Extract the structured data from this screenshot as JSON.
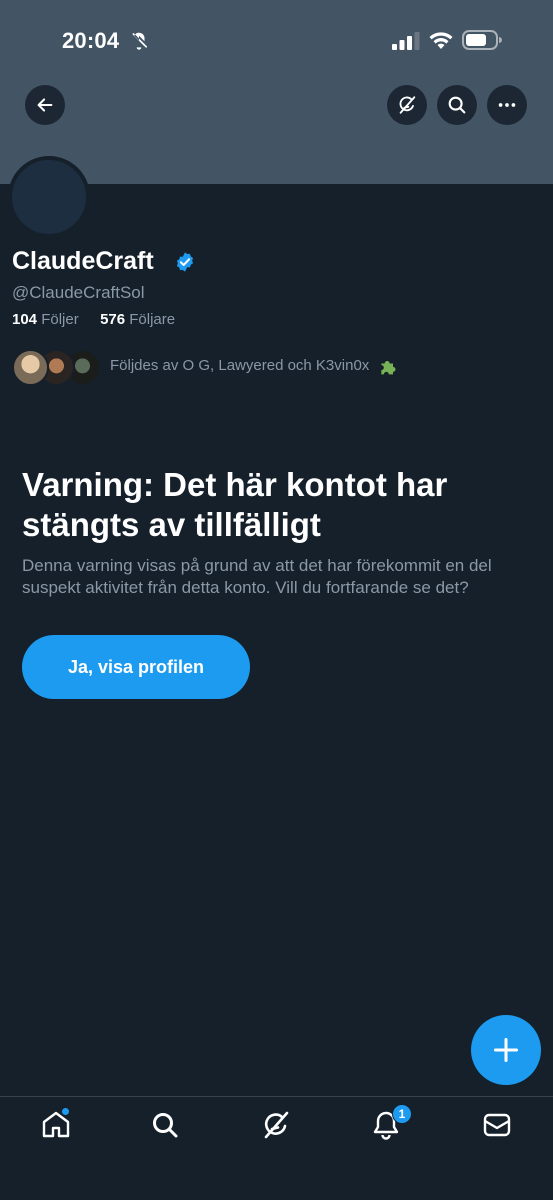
{
  "status_bar": {
    "time": "20:04",
    "icons": [
      "bell-off-icon",
      "signal-icon",
      "wifi-icon",
      "battery-icon"
    ]
  },
  "header": {
    "buttons": [
      "back-arrow-icon",
      "grok-icon",
      "search-icon",
      "more-icon"
    ]
  },
  "profile": {
    "display_name": "ClaudeCraft",
    "verified": true,
    "handle": "@ClaudeCraftSol",
    "following_count": "104",
    "following_label": "Följer",
    "followers_count": "576",
    "followers_label": "Följare",
    "followed_by_text": "Följdes av O G, Lawyered och K3vin0x"
  },
  "warning": {
    "title": "Varning: Det här kontot har stängts av tillfälligt",
    "text": "Denna varning visas på grund av att det har förekommit en del suspekt aktivitet från detta konto. Vill du fortfarande se det?",
    "button_label": "Ja, visa profilen"
  },
  "bottom_nav": {
    "items": [
      "home-icon",
      "search-icon",
      "grok-icon",
      "notifications-icon",
      "messages-icon"
    ],
    "notification_badge": "1"
  },
  "colors": {
    "background": "#15202b",
    "banner": "#435565",
    "accent": "#1d9bf0",
    "secondary_text": "#8b98a5"
  }
}
